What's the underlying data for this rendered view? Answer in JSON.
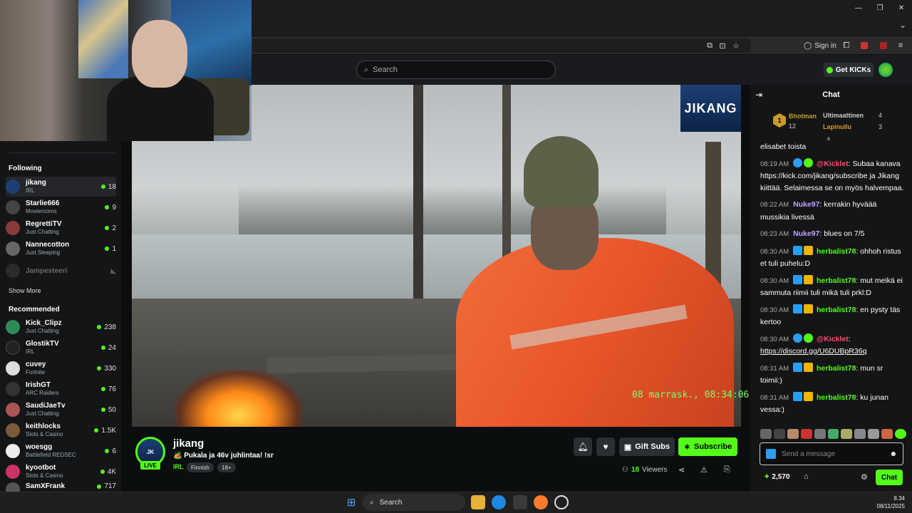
{
  "browser": {
    "signin_label": "Sign in"
  },
  "header": {
    "search_placeholder": "Search",
    "get_kicks_label": "Get KICKs"
  },
  "sidebar": {
    "following_title": "Following",
    "following": [
      {
        "name": "jikang",
        "category": "IRL",
        "viewers": "18",
        "active": true,
        "color": "#1d3f74"
      },
      {
        "name": "Starlie666",
        "category": "Movierooms",
        "viewers": "9",
        "color": "#444"
      },
      {
        "name": "RegrettiTV",
        "category": "Just Chatting",
        "viewers": "2",
        "color": "#8a3a3a"
      },
      {
        "name": "Nannecotton",
        "category": "Just Sleeping",
        "viewers": "1",
        "color": "#666"
      }
    ],
    "offline_channel": "Jampesteeri",
    "show_more_label": "Show More",
    "recommended_title": "Recommended",
    "recommended": [
      {
        "name": "Kick_Clipz",
        "category": "Just Chatting",
        "viewers": "238",
        "color": "#2e8b57"
      },
      {
        "name": "GlostikTV",
        "category": "IRL",
        "viewers": "24",
        "color": "#222"
      },
      {
        "name": "cuvey",
        "category": "Fortnite",
        "viewers": "330",
        "color": "#ddd"
      },
      {
        "name": "IrishGT",
        "category": "ARC Raiders",
        "viewers": "76",
        "color": "#333"
      },
      {
        "name": "SaudiJaeTv",
        "category": "Just Chatting",
        "viewers": "50",
        "color": "#a55"
      },
      {
        "name": "keithlocks",
        "category": "Slots & Casino",
        "viewers": "1.5K",
        "color": "#7a5a3a"
      },
      {
        "name": "woesgg",
        "category": "Battlefield REDSEC",
        "viewers": "6",
        "color": "#eee"
      },
      {
        "name": "kyootbot",
        "category": "Slots & Casino",
        "viewers": "4K",
        "color": "#c36"
      },
      {
        "name": "SamXFrank",
        "category": "",
        "viewers": "717",
        "color": "#555"
      }
    ]
  },
  "video": {
    "overlay_logo": "JIKANG",
    "timestamp": "08 marrask., 08:34:06"
  },
  "stream": {
    "channel": "jikang",
    "live_label": "LIVE",
    "title": "🏕️ Pukala ja 46v juhlintaa! !sr",
    "category": "IRL",
    "tags": [
      "Finnish",
      "18+"
    ],
    "gift_subs_label": "Gift Subs",
    "subscribe_label": "Subscribe",
    "viewers_count": "18",
    "viewers_label": "Viewers"
  },
  "chat": {
    "title": "Chat",
    "leaderboard": {
      "first_name": "Bhotman",
      "first_count": "12",
      "second_name": "Ultimaattinen",
      "second_count": "4",
      "third_name": "Lapinullu",
      "third_count": "3"
    },
    "messages": [
      {
        "time": "",
        "user": "",
        "user_color": "#fff",
        "text": "elisabet toista"
      },
      {
        "time": "08:19 AM",
        "user": "@Kicklet",
        "user_color": "#ff4d6d",
        "text": "Subaa kanava https://kick.com/jikang/subscribe ja Jikang kiittää. Selaimessa se on myös halvempaa."
      },
      {
        "time": "08:22 AM",
        "user": "Nuke97",
        "user_color": "#c8a0ff",
        "text": "kerrakin hyväää mussikia livessä"
      },
      {
        "time": "08:23 AM",
        "user": "Nuke97",
        "user_color": "#c8a0ff",
        "text": "blues on 7/5"
      },
      {
        "time": "08:30 AM",
        "user": "herbalist78",
        "user_color": "#53fc18",
        "text": "ohhoh ristus et tuli puhelu:D"
      },
      {
        "time": "08:30 AM",
        "user": "herbalist78",
        "user_color": "#53fc18",
        "text": "mut meikä ei sammuta riimii tuli mikä tuli prkl:D"
      },
      {
        "time": "08:30 AM",
        "user": "herbalist78",
        "user_color": "#53fc18",
        "text": "en pysty täs kertoo"
      },
      {
        "time": "08:30 AM",
        "user": "@Kicklet",
        "user_color": "#ff4d6d",
        "text": "https://discord.gg/U6DUBpR36q"
      },
      {
        "time": "08:31 AM",
        "user": "herbalist78",
        "user_color": "#53fc18",
        "text": "mun sr toimii:)"
      },
      {
        "time": "08:31 AM",
        "user": "herbalist78",
        "user_color": "#53fc18",
        "text": "ku junan vessa:)"
      }
    ],
    "input_placeholder": "Send a message",
    "points": "2,570",
    "send_label": "Chat"
  },
  "taskbar": {
    "search_label": "Search",
    "time": "8.34",
    "date": "08/11/2025"
  },
  "colors": {
    "accent": "#53fc18",
    "background": "#0b0e0f",
    "panel": "#141517"
  }
}
